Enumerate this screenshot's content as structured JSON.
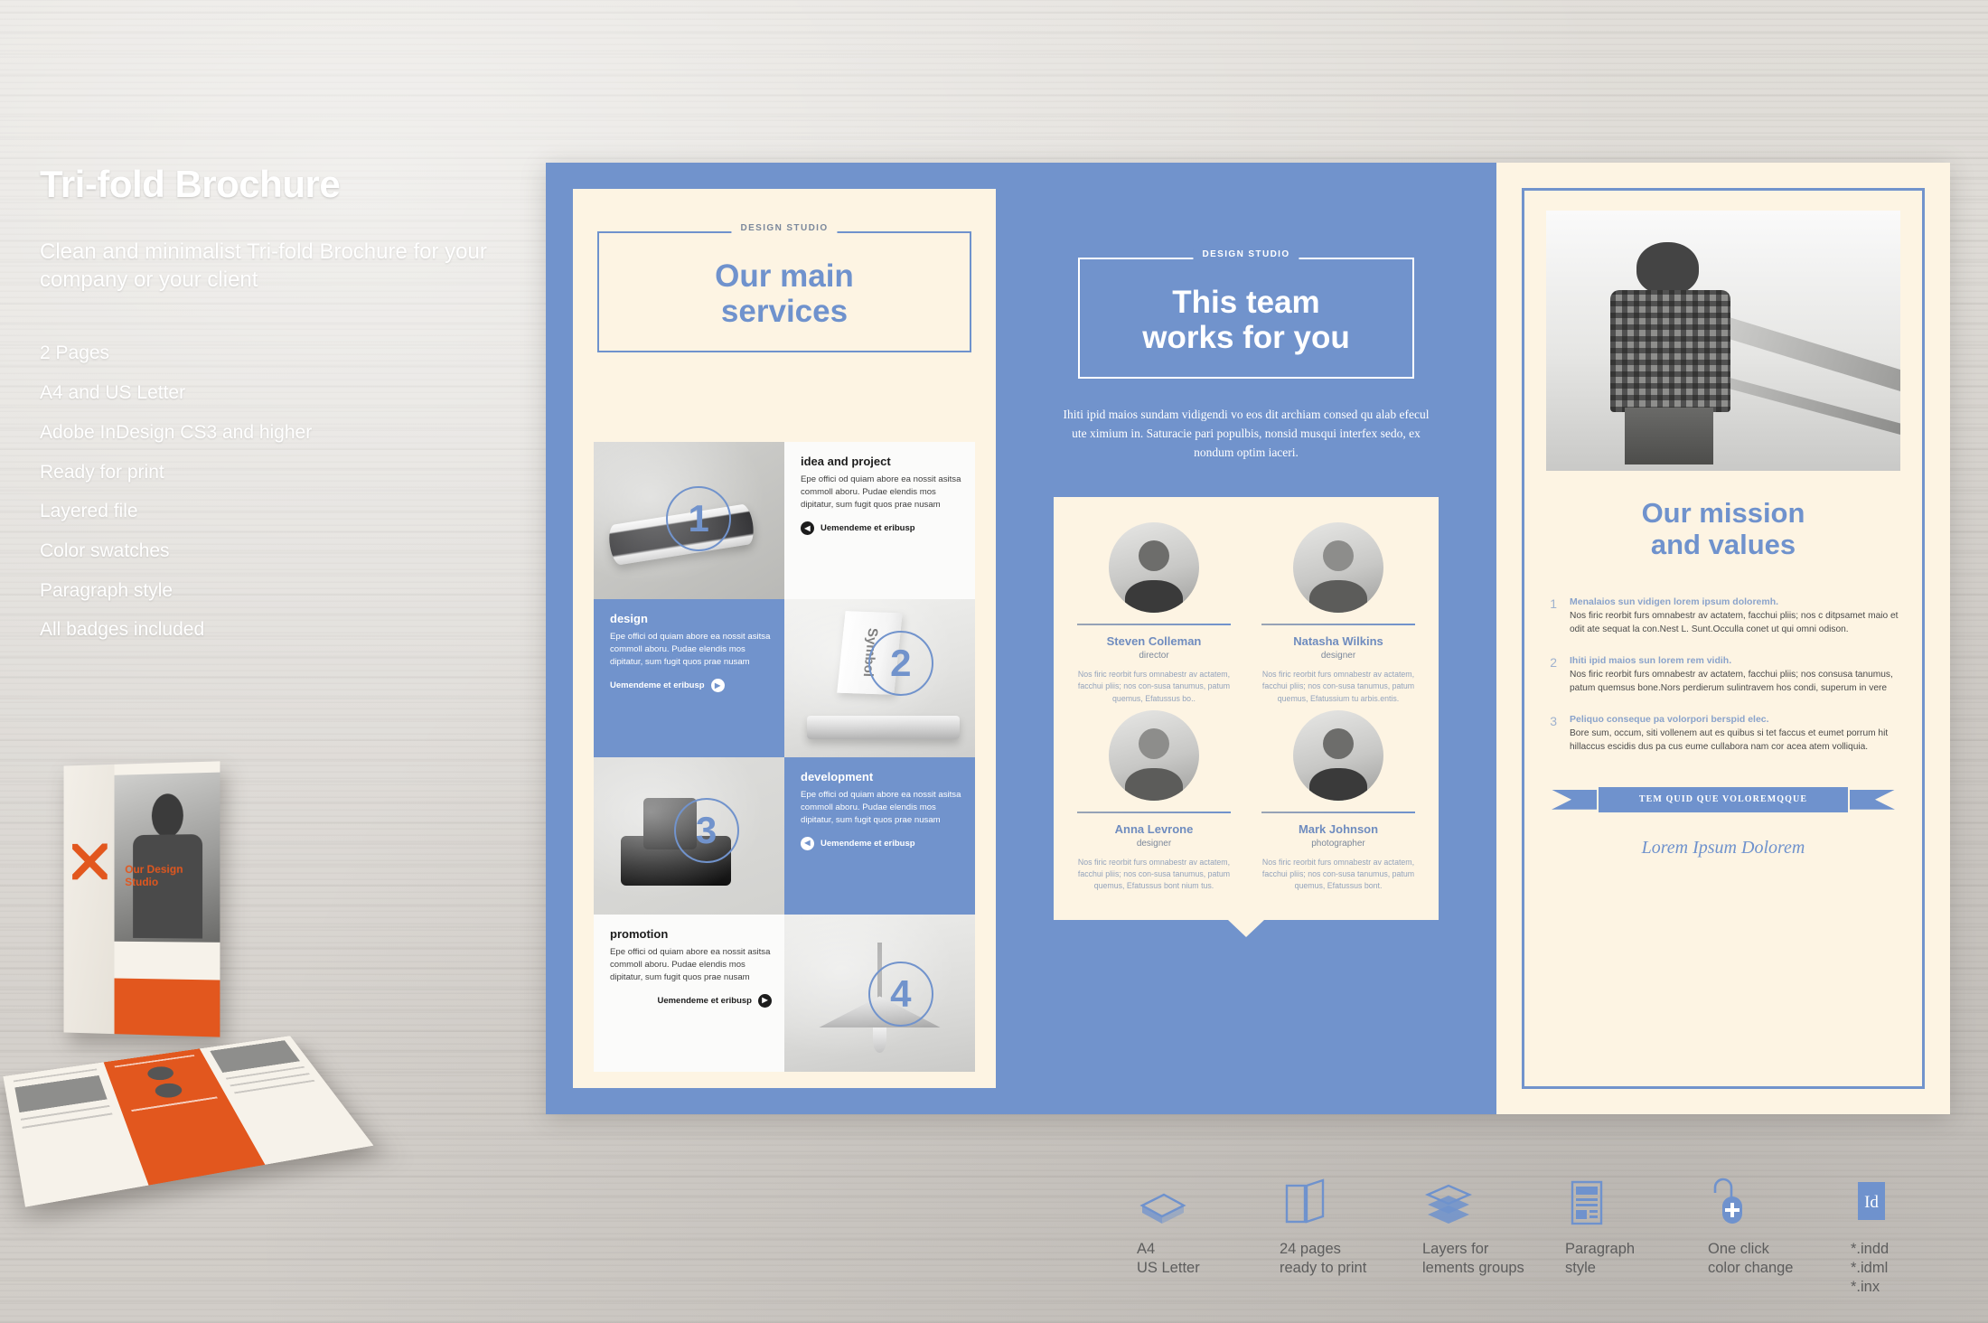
{
  "promo": {
    "title": "Tri-fold Brochure",
    "subtitle": "Clean and minimalist Tri-fold Brochure for your company or your client",
    "features": [
      "2 Pages",
      "A4 and US Letter",
      "Adobe InDesign CS3 and higher",
      "Ready for print",
      "Layered file",
      "Color swatches",
      "Paragraph style",
      "All badges included"
    ]
  },
  "colors": {
    "brand_blue": "#7193cc",
    "cream": "#fdf4e3",
    "accent_orange": "#e2571e",
    "body_text": "#4a4a4a"
  },
  "services_panel": {
    "kicker": "DESIGN STUDIO",
    "title_line1": "Our main",
    "title_line2": "services",
    "items": [
      {
        "number": "1",
        "heading": "idea and project",
        "body": "Epe offici od quiam abore ea nossit asitsa commoll aboru. Pudae elendis mos dipitatur, sum fugit quos prae nusam",
        "cta": "Uemendeme et eribusp",
        "image": "smartphone-photo"
      },
      {
        "number": "2",
        "heading": "design",
        "body": "Epe offici od quiam abore ea nossit asitsa commoll aboru. Pudae elendis mos dipitatur, sum fugit quos prae nusam",
        "cta": "Uemendeme et eribusp",
        "image": "laptop-and-book-photo",
        "image_caption": "Symbol"
      },
      {
        "number": "3",
        "heading": "development",
        "body": "Epe offici od quiam abore ea nossit asitsa commoll aboru. Pudae elendis mos dipitatur, sum fugit quos prae nusam",
        "cta": "Uemendeme et eribusp",
        "image": "camera-photo"
      },
      {
        "number": "4",
        "heading": "promotion",
        "body": "Epe offici od quiam abore ea nossit asitsa commoll aboru. Pudae elendis mos dipitatur, sum fugit quos prae nusam",
        "cta": "Uemendeme et eribusp",
        "image": "pendant-lamp-photo"
      }
    ]
  },
  "team_panel": {
    "kicker": "DESIGN STUDIO",
    "title_line1": "This team",
    "title_line2": "works for you",
    "lede": "Ihiti ipid maios sundam vidigendi vo eos dit archiam consed qu alab efecul ute ximium in. Saturacie pari populbis, nonsid musqui interfex sedo, ex nondum optim iaceri.",
    "members": [
      {
        "name": "Steven Colleman",
        "role": "director",
        "bio": "Nos firic reorbit furs omnabestr av actatem, facchui pliis; nos con-susa tanumus, patum quemus, Efatussus bo.."
      },
      {
        "name": "Natasha Wilkins",
        "role": "designer",
        "bio": "Nos firic reorbit furs omnabestr av actatem, facchui pliis; nos con-susa tanumus, patum quemus, Efatussium tu arbis.entis."
      },
      {
        "name": "Anna Levrone",
        "role": "designer",
        "bio": "Nos firic reorbit furs omnabestr av actatem, facchui pliis; nos con-susa tanumus, patum quemus, Efatussus bont nium tus."
      },
      {
        "name": "Mark Johnson",
        "role": "photographer",
        "bio": "Nos firic reorbit furs omnabestr av actatem, facchui pliis; nos con-susa tanumus, patum quemus, Efatussus bont."
      }
    ]
  },
  "mission_panel": {
    "photo_alt": "bearded-man-on-bridge-photo",
    "title_line1": "Our mission",
    "title_line2": "and values",
    "points": [
      {
        "number": "1",
        "lead": "Menalaios sun vidigen lorem ipsum doloremh.",
        "body": "Nos firic reorbit furs omnabestr av actatem, facchui pliis; nos c ditpsamet maio et odit ate sequat la con.Nest L. Sunt.Occulla conet ut qui omni odison."
      },
      {
        "number": "2",
        "lead": "Ihiti ipid maios sun lorem rem vidih.",
        "body": "Nos firic reorbit furs omnabestr av actatem, facchui pliis; nos consusa tanumus, patum quemsus bone.Nors perdierum sulintravem hos condi, superum in vere"
      },
      {
        "number": "3",
        "lead": "Peliquo conseque pa volorpori berspid elec.",
        "body": "Bore sum, occum, siti vollenem aut es quibus si tet faccus et eumet porrum hit hillaccus escidis dus pa cus eume cullabora nam cor acea atem volliquia."
      }
    ],
    "ribbon": "TEM QUID QUE VOLOREMQQUE",
    "signature": "Lorem Ipsum Dolorem"
  },
  "badges": [
    {
      "icon": "paper-stack-icon",
      "line1": "A4",
      "line2": "US Letter",
      "line3": ""
    },
    {
      "icon": "open-book-icon",
      "line1": "24 pages",
      "line2": "ready to print",
      "line3": ""
    },
    {
      "icon": "layers-icon",
      "line1": "Layers for",
      "line2": "lements groups",
      "line3": ""
    },
    {
      "icon": "document-icon",
      "line1": "Paragraph",
      "line2": "style",
      "line3": ""
    },
    {
      "icon": "mouse-click-icon",
      "line1": "One click",
      "line2": "color change",
      "line3": ""
    },
    {
      "icon": "indesign-id-icon",
      "line1": "*.indd",
      "line2": "*.idml",
      "line3": "*.inx"
    }
  ]
}
